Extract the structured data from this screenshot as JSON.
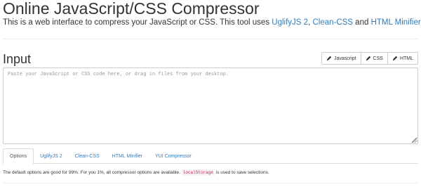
{
  "header": {
    "title": "Online JavaScript/CSS Compressor",
    "intro_prefix": "This is a web interface to compress your JavaScript or CSS. This tool uses ",
    "links": [
      "UglifyJS 2",
      "Clean-CSS",
      "HTML Minifier"
    ],
    "separator_comma": ", ",
    "separator_and": " and ",
    "intro_suffix": "."
  },
  "input_section": {
    "title": "Input",
    "modes": [
      {
        "label": "Javascript",
        "icon": "pencil-icon"
      },
      {
        "label": "CSS",
        "icon": "pencil-icon"
      },
      {
        "label": "HTML",
        "icon": "pencil-icon"
      }
    ],
    "editor_placeholder": "Paste your JavaScript or CSS code here, or drag in files from your desktop.",
    "editor_value": ""
  },
  "tabs": [
    {
      "label": "Options",
      "active": true
    },
    {
      "label": "UglifyJS 2",
      "active": false
    },
    {
      "label": "Clean-CSS",
      "active": false
    },
    {
      "label": "HTML Minifier",
      "active": false
    },
    {
      "label": "YUI Compressor",
      "active": false
    }
  ],
  "options_panel": {
    "text_before": "The default options are good for 99%. For you 1%, all compressor options are available. ",
    "code": "localStorage",
    "text_after": " is used to save selections."
  },
  "colors": {
    "link": "#337ab7",
    "text": "#333333",
    "code_text": "#c7254e",
    "code_bg": "#f9f2f4",
    "border": "#cccccc"
  }
}
